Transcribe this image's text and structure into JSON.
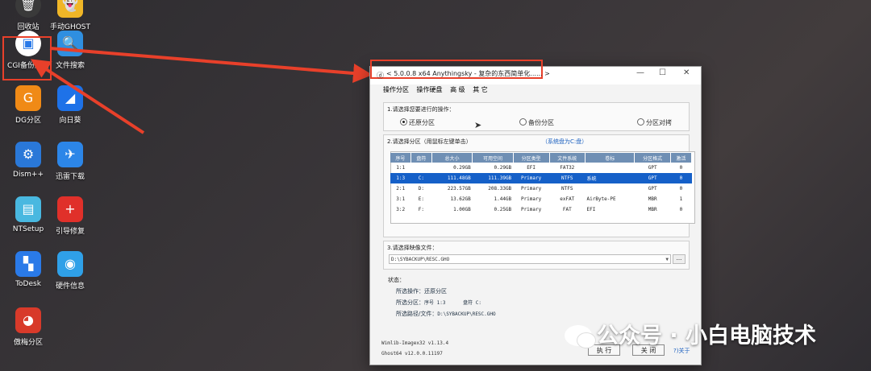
{
  "desktop": {
    "icons": [
      {
        "label": "回收站",
        "color": "#3a3a3a",
        "glyph": "🗑"
      },
      {
        "label": "手动GHOST",
        "color": "#f0b627",
        "glyph": "👻"
      },
      {
        "label": "CGI备份还原",
        "color": "#ffffff",
        "glyph": "▣"
      },
      {
        "label": "文件搜索",
        "color": "#2f8fe0",
        "glyph": "🔍"
      },
      {
        "label": "DG分区",
        "color": "#f08a16",
        "glyph": "G"
      },
      {
        "label": "向日葵",
        "color": "#1e72e8",
        "glyph": "◢"
      },
      {
        "label": "Dism++",
        "color": "#2a78d8",
        "glyph": "⚙"
      },
      {
        "label": "迅雷下载",
        "color": "#2c86e8",
        "glyph": "✈"
      },
      {
        "label": "NTSetup",
        "color": "#49b8e0",
        "glyph": "▤"
      },
      {
        "label": "引导修复",
        "color": "#e0302a",
        "glyph": "+"
      },
      {
        "label": "ToDesk",
        "color": "#2a7ae8",
        "glyph": "▚"
      },
      {
        "label": "硬件信息",
        "color": "#2fa0e8",
        "glyph": "◉"
      },
      {
        "label": "傲梅分区",
        "color": "#d83a2a",
        "glyph": "◕"
      }
    ]
  },
  "window": {
    "title": "< 5.0.0.8 x64 Anythingsky - 复杂的东西简单化...... >",
    "menu": [
      "操作分区",
      "操作硬盘",
      "高 级",
      "其 它"
    ],
    "step1": {
      "title": "1.请选择您要进行的操作：",
      "options": [
        "还原分区",
        "备份分区",
        "分区对拷"
      ]
    },
    "step2": {
      "title": "2.请选择分区（用鼠标左键单击）",
      "system_disk": "（系统盘为C:盘）",
      "columns": [
        "序号",
        "盘符",
        "总大小",
        "可用空间",
        "分区类型",
        "文件系统",
        "卷标",
        "分区格式",
        "激活"
      ],
      "rows": [
        [
          "1:1",
          "",
          "0.29GB",
          "0.29GB",
          "EFI",
          "FAT32",
          "",
          "GPT",
          "0"
        ],
        [
          "1:3",
          "C:",
          "111.48GB",
          "111.39GB",
          "Primary",
          "NTFS",
          "系统",
          "GPT",
          "0"
        ],
        [
          "2:1",
          "D:",
          "223.57GB",
          "208.33GB",
          "Primary",
          "NTFS",
          "",
          "GPT",
          "0"
        ],
        [
          "3:1",
          "E:",
          "13.62GB",
          "1.44GB",
          "Primary",
          "exFAT",
          "AirByte-PE",
          "MBR",
          "1"
        ],
        [
          "3:2",
          "F:",
          "1.00GB",
          "0.25GB",
          "Primary",
          "FAT",
          "EFI",
          "MBR",
          "0"
        ]
      ],
      "selected_row": 1
    },
    "step3": {
      "title": "3.请选择映像文件：",
      "path": "D:\\SYBACKUP\\RESC.GHO",
      "browse": "..."
    },
    "status": {
      "title": "状态：",
      "operation_label": "所选操作：",
      "operation_value": "还原分区",
      "partition_label": "所选分区：",
      "partition_value": "序号 1:3      盘符 C:",
      "path_label": "所选路径/文件：",
      "path_value": "D:\\SYBACKUP\\RESC.GHO"
    },
    "footer": {
      "line1": "Wimlib-Imagex32 v1.13.4",
      "line2": "Ghost64 v12.0.0.11197"
    },
    "buttons": {
      "execute": "执 行",
      "close": "关 闭",
      "about": "?)关于"
    }
  },
  "watermark": "公众号 · 小白电脑技术",
  "accent": "#e8402a"
}
